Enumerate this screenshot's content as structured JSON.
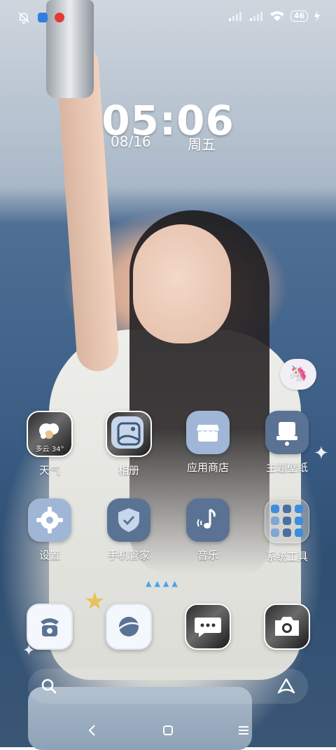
{
  "status_bar": {
    "battery_level": "46",
    "icons": [
      "bell-off-icon",
      "app-notification-icon",
      "app-notification-icon",
      "signal-icon",
      "signal-icon",
      "wifi-icon",
      "battery-icon",
      "charging-icon"
    ]
  },
  "clock": {
    "time": "05:06",
    "date": "08/16",
    "weekday": "周五"
  },
  "apps_row1": [
    {
      "label": "天气",
      "icon": "weather-icon",
      "widget_text": "多云 34°"
    },
    {
      "label": "相册",
      "icon": "gallery-icon"
    },
    {
      "label": "应用商店",
      "icon": "app-store-icon"
    },
    {
      "label": "主题壁纸",
      "icon": "themes-icon"
    }
  ],
  "apps_row2": [
    {
      "label": "设置",
      "icon": "gear-icon"
    },
    {
      "label": "手机管家",
      "icon": "shield-icon"
    },
    {
      "label": "音乐",
      "icon": "music-icon"
    },
    {
      "label": "系统工具",
      "icon": "folder-icon"
    }
  ],
  "dock": [
    {
      "icon": "phone-icon"
    },
    {
      "icon": "browser-icon"
    },
    {
      "icon": "message-icon"
    },
    {
      "icon": "camera-icon"
    }
  ],
  "page_indicator": "▲▲▲▲",
  "colors": {
    "icon_blue": "#9fb6d6",
    "icon_dark_blue": "#5a7395",
    "icon_light": "#f4f7fb"
  }
}
